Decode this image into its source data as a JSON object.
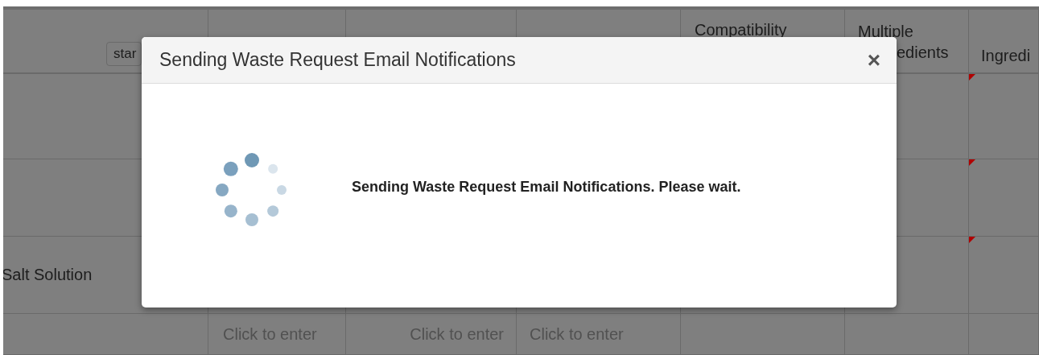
{
  "table": {
    "columns": [
      {
        "kind": "button",
        "label": "star"
      },
      {
        "kind": "blank"
      },
      {
        "kind": "blank"
      },
      {
        "kind": "blank"
      },
      {
        "kind": "text",
        "label": "Compatibility"
      },
      {
        "kind": "lines",
        "lines": [
          "Multiple",
          "edients"
        ]
      },
      {
        "kind": "text",
        "label": "Ingredi"
      }
    ],
    "rows": [
      {
        "flagged": true
      },
      {
        "flagged": true
      },
      {
        "name": "Salt Solution",
        "flagged": true
      },
      {
        "placeholders": [
          "Click to enter",
          "Click to enter",
          "Click to enter"
        ],
        "flagged": false
      }
    ]
  },
  "modal": {
    "title": "Sending Waste Request Email Notifications",
    "close": "×",
    "message": "Sending Waste Request Email Notifications. Please wait."
  }
}
